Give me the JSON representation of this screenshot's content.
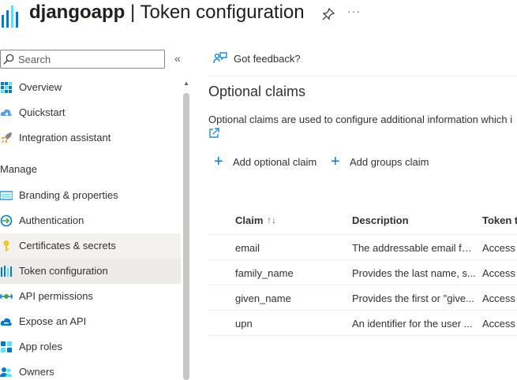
{
  "header": {
    "app_name": "djangoapp",
    "separator": "|",
    "page_name": "Token configuration",
    "more": "···"
  },
  "sidebar": {
    "search": {
      "placeholder": "Search",
      "value": ""
    },
    "collapse": "«",
    "items": [
      {
        "label": "Overview",
        "icon": "grid-icon"
      },
      {
        "label": "Quickstart",
        "icon": "cloud-icon"
      },
      {
        "label": "Integration assistant",
        "icon": "rocket-icon"
      }
    ],
    "section": "Manage",
    "manage_items": [
      {
        "label": "Branding & properties",
        "icon": "branding-icon"
      },
      {
        "label": "Authentication",
        "icon": "auth-icon"
      },
      {
        "label": "Certificates & secrets",
        "icon": "key-icon"
      },
      {
        "label": "Token configuration",
        "icon": "token-icon",
        "selected": true
      },
      {
        "label": "API permissions",
        "icon": "api-permissions-icon"
      },
      {
        "label": "Expose an API",
        "icon": "cloud-api-icon"
      },
      {
        "label": "App roles",
        "icon": "app-roles-icon"
      },
      {
        "label": "Owners",
        "icon": "owners-icon"
      }
    ]
  },
  "main": {
    "feedback": "Got feedback?",
    "title": "Optional claims",
    "description": "Optional claims are used to configure additional information which i",
    "actions": {
      "add_optional_claim": "Add optional claim",
      "add_groups_claim": "Add groups claim"
    },
    "table": {
      "columns": [
        "Claim",
        "Description",
        "Token t"
      ],
      "sort_indicator": "↑↓",
      "rows": [
        {
          "claim": "email",
          "description": "The addressable email for...",
          "token": "Access"
        },
        {
          "claim": "family_name",
          "description": "Provides the last name, s...",
          "token": "Access"
        },
        {
          "claim": "given_name",
          "description": "Provides the first or \"give...",
          "token": "Access"
        },
        {
          "claim": "upn",
          "description": "An identifier for the user ...",
          "token": "Access"
        }
      ]
    }
  },
  "colors": {
    "accent": "#0078d4",
    "selected_bg": "#edebe9",
    "key_yellow": "#f2c811"
  }
}
